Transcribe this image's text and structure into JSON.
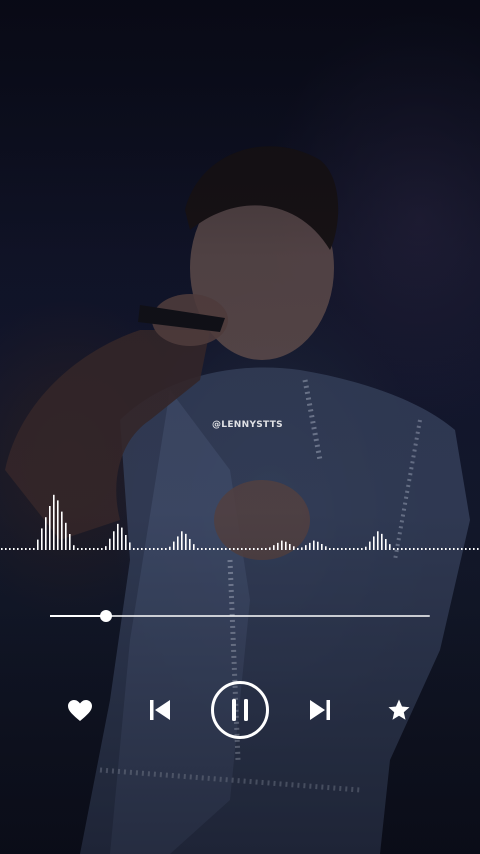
{
  "watermark": "@LENNYSTTS",
  "player": {
    "progress_fraction": 0.147,
    "state": "playing"
  },
  "controls": {
    "like_icon": "heart-icon",
    "previous_icon": "skip-previous-icon",
    "play_pause_icon": "pause-icon",
    "next_icon": "skip-next-icon",
    "favorite_icon": "star-icon"
  },
  "colors": {
    "accent": "#ffffff",
    "background": "#0b0d17"
  }
}
